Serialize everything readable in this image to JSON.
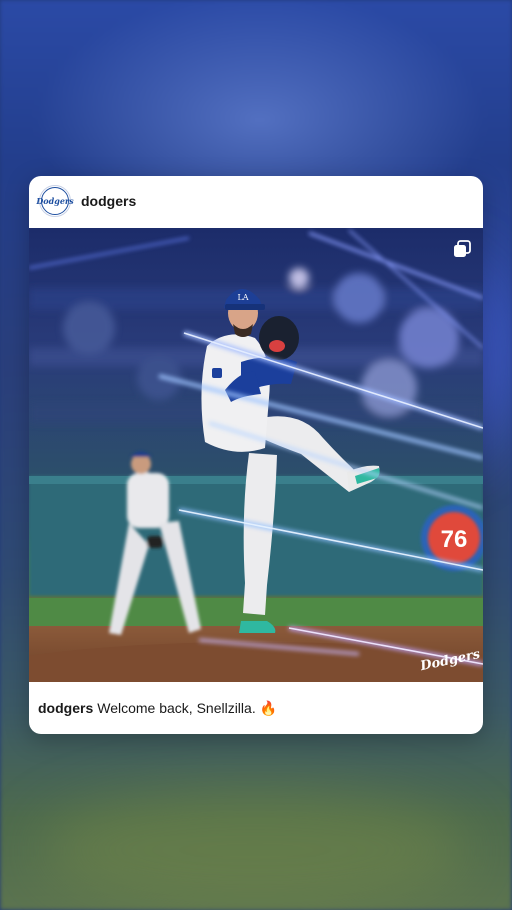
{
  "post": {
    "username": "dodgers",
    "avatar_text": "Dodgers",
    "caption_user": "dodgers",
    "caption_text": "Welcome back, Snellzilla.",
    "caption_emoji": "🔥",
    "scoreboard_sign": "76",
    "watermark": "Dodgers",
    "icons": {
      "multi_photo": "multiple-photos-icon",
      "fire": "fire-emoji"
    }
  },
  "colors": {
    "card_bg": "#ffffff",
    "brand_blue": "#1e4fa0",
    "text": "#1a1a1a"
  }
}
